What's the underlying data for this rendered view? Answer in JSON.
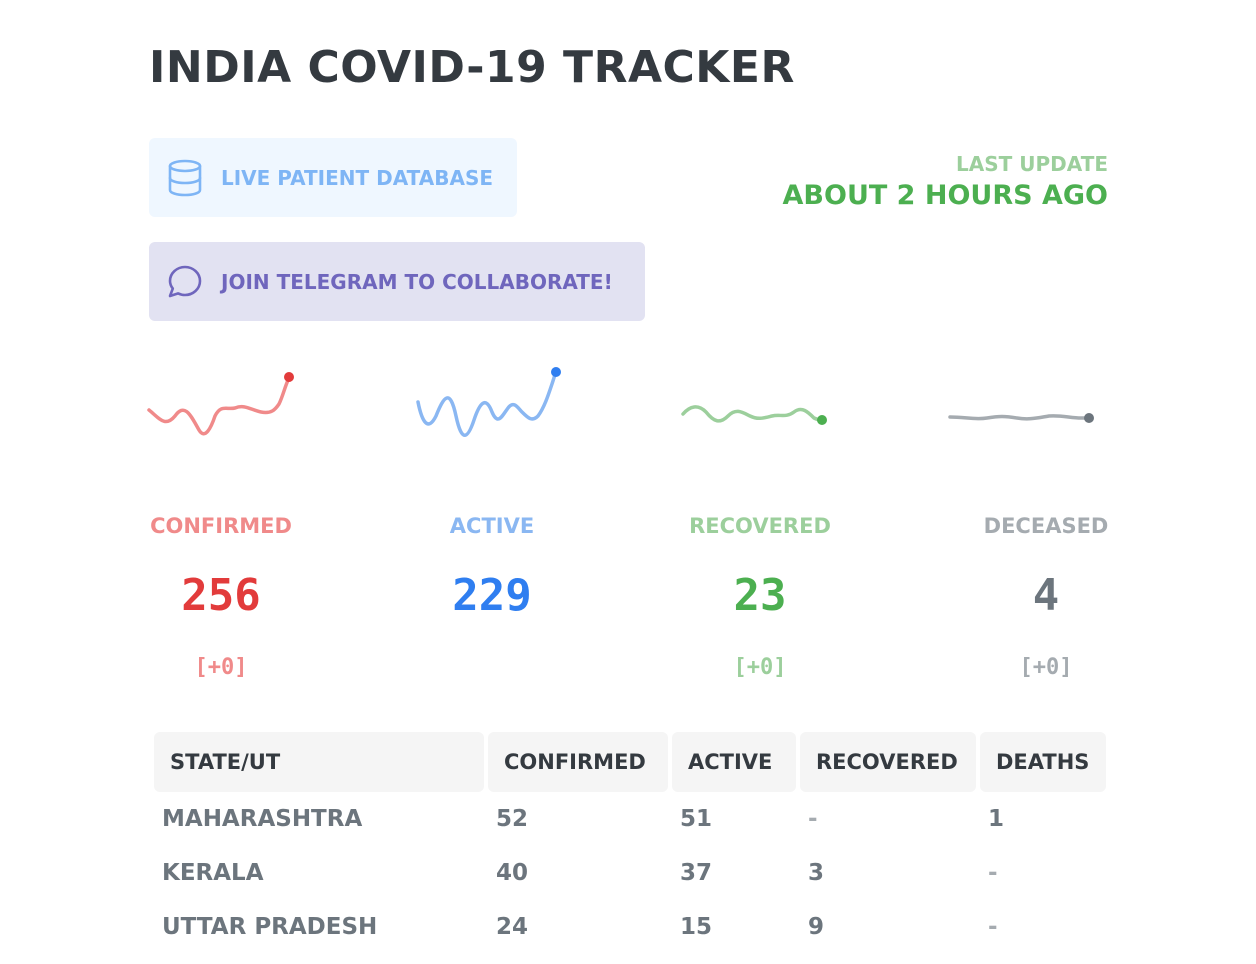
{
  "header": {
    "title": "INDIA COVID-19 TRACKER"
  },
  "links": {
    "database": {
      "label": "LIVE PATIENT DATABASE",
      "icon": "database-icon"
    },
    "telegram": {
      "label": "JOIN TELEGRAM TO COLLABORATE!",
      "icon": "message-circle-icon"
    }
  },
  "last_update": {
    "label": "LAST UPDATE",
    "value": "ABOUT 2 HOURS AGO"
  },
  "colors": {
    "confirmed": "#e23b3b",
    "confirmed_light": "#f08a8a",
    "active": "#2f7ef0",
    "active_light": "#8ab7f2",
    "recovered": "#4caf50",
    "recovered_light": "#9ccf9c",
    "deceased": "#6c757d",
    "deceased_light": "#a5abb0"
  },
  "stats": [
    {
      "key": "confirmed",
      "label": "CONFIRMED",
      "value": "256",
      "delta": "[+0]"
    },
    {
      "key": "active",
      "label": "ACTIVE",
      "value": "229",
      "delta": ""
    },
    {
      "key": "recovered",
      "label": "RECOVERED",
      "value": "23",
      "delta": "[+0]"
    },
    {
      "key": "deceased",
      "label": "DECEASED",
      "value": "4",
      "delta": "[+0]"
    }
  ],
  "table": {
    "headers": [
      "STATE/UT",
      "CONFIRMED",
      "ACTIVE",
      "RECOVERED",
      "DEATHS"
    ],
    "rows": [
      [
        "MAHARASHTRA",
        "52",
        "51",
        "-",
        "1"
      ],
      [
        "KERALA",
        "40",
        "37",
        "3",
        "-"
      ],
      [
        "UTTAR PRADESH",
        "24",
        "15",
        "9",
        "-"
      ]
    ]
  }
}
